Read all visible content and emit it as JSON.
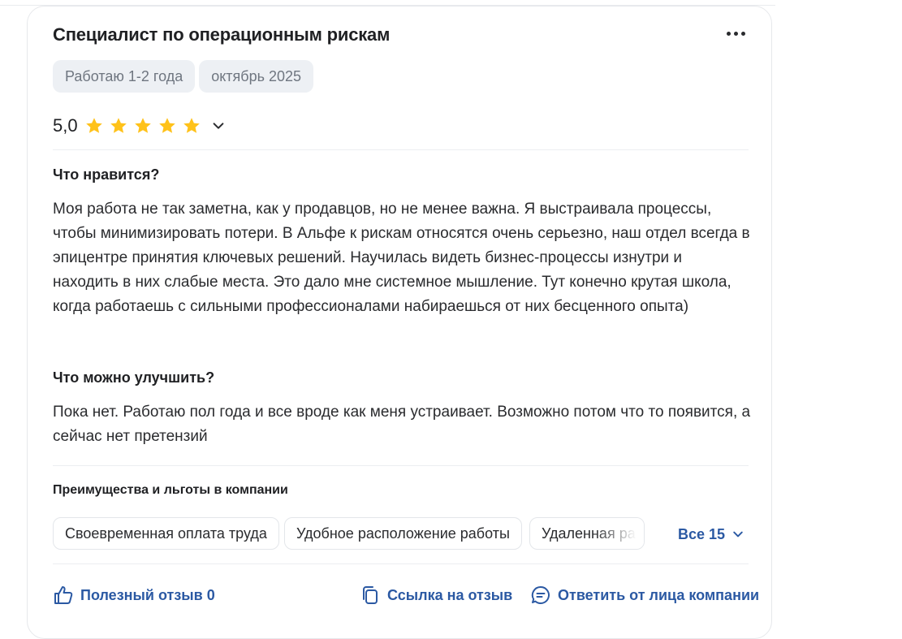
{
  "review": {
    "title": "Специалист по операционным рискам",
    "tags": [
      "Работаю 1-2 года",
      "октябрь 2025"
    ],
    "rating": "5,0",
    "stars": 5,
    "likes": {
      "heading": "Что нравится?",
      "text": "Моя работа не так заметна, как у продавцов, но не менее важна. Я выстраивала процессы, чтобы минимизировать потери. В Альфе к рискам относятся очень серьезно, наш отдел всегда в эпицентре принятия ключевых решений. Научилась видеть бизнес-процессы изнутри и находить в них слабые места. Это дало мне системное мышление. Тут конечно крутая школа, когда работаешь с сильными профессионалами набираешься от них бесценного опыта)"
    },
    "improve": {
      "heading": "Что можно улучшить?",
      "text": "Пока нет. Работаю пол года и все вроде как меня устраивает. Возможно потом что то появится, а сейчас нет претензий"
    },
    "benefits": {
      "heading": "Преимущества и льготы в компании",
      "items": [
        "Своевременная оплата труда",
        "Удобное расположение работы",
        "Удаленная работа"
      ],
      "all_label": "Все 15"
    },
    "actions": {
      "useful": "Полезный отзыв 0",
      "link": "Ссылка на отзыв",
      "reply": "Ответить от лица компании"
    }
  },
  "colors": {
    "accent": "#2b59a3",
    "star": "#ffc21a",
    "chip_bg": "#edf0f4"
  },
  "icons": [
    "more-icon",
    "star-icon",
    "chevron-down-icon",
    "thumb-up-icon",
    "copy-link-icon",
    "reply-icon"
  ]
}
